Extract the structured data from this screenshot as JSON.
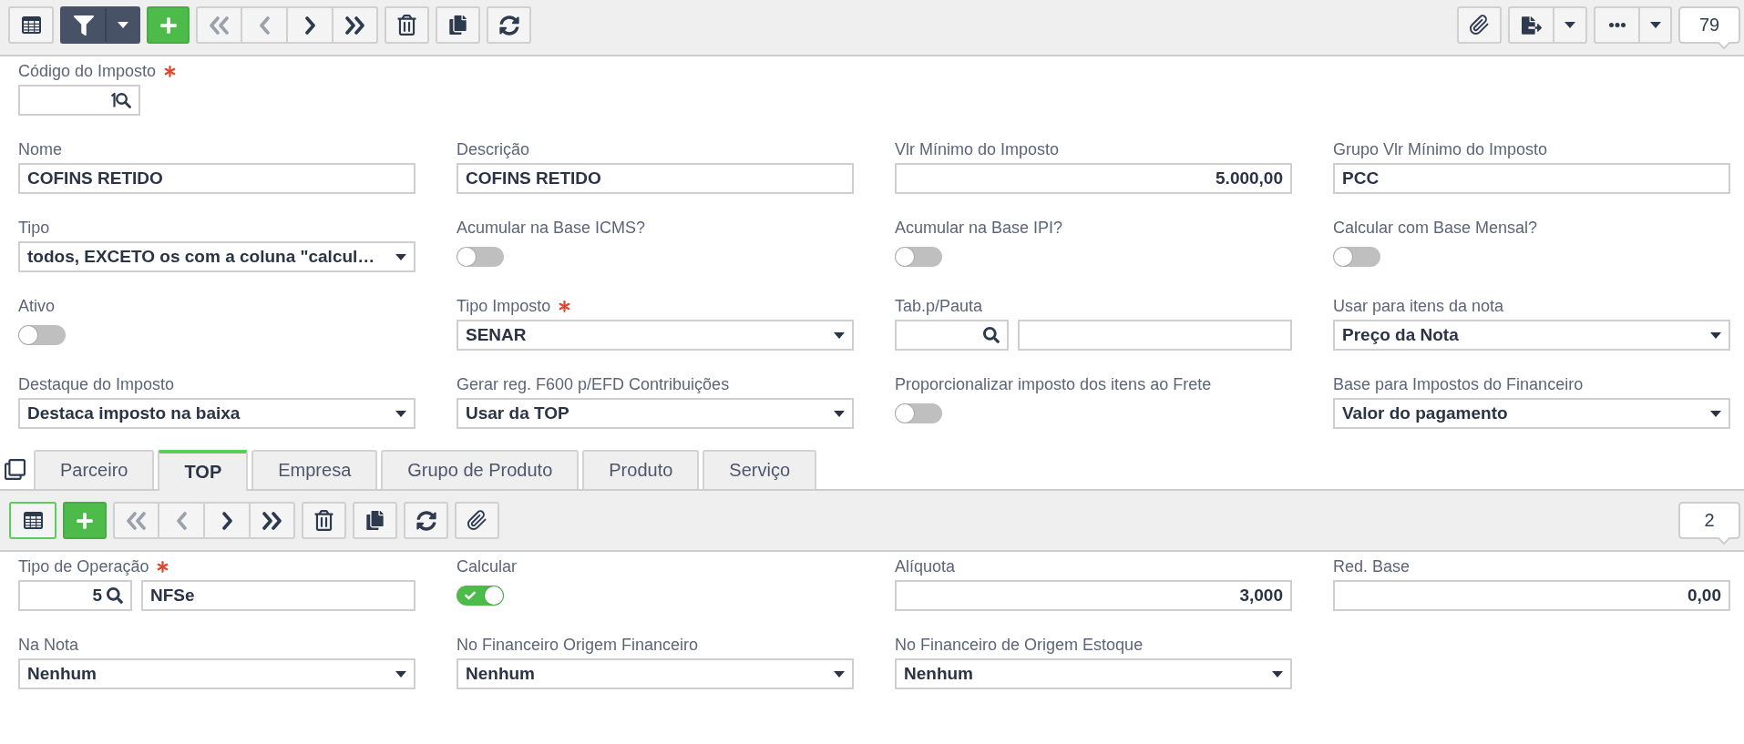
{
  "toolbar": {
    "grid_active": false,
    "navigation": [
      {
        "disabled": true
      },
      {
        "disabled": true
      },
      {
        "disabled": false
      },
      {
        "disabled": false
      }
    ],
    "record_count": "79"
  },
  "main_form": {
    "code_field": {
      "label": "Código do Imposto",
      "required": true
    },
    "fields": [
      {
        "kind": "text",
        "label": "Nome",
        "required": false,
        "value": "COFINS RETIDO"
      },
      {
        "kind": "text",
        "label": "Descrição",
        "required": false,
        "value": "COFINS RETIDO"
      },
      {
        "kind": "number",
        "label": "Vlr Mínimo do Imposto",
        "required": false,
        "value": "5.000,00"
      },
      {
        "kind": "text",
        "label": "Grupo Vlr Mínimo do Imposto",
        "required": false,
        "value": "PCC"
      },
      {
        "kind": "select",
        "label": "Tipo",
        "required": false,
        "value": "todos, EXCETO os com a coluna \"calcul…"
      },
      {
        "kind": "toggle",
        "label": "Acumular na Base ICMS?",
        "required": false,
        "on": false
      },
      {
        "kind": "toggle",
        "label": "Acumular na Base IPI?",
        "required": false,
        "on": false
      },
      {
        "kind": "toggle",
        "label": "Calcular com Base Mensal?",
        "required": false,
        "on": false
      },
      {
        "kind": "toggle",
        "label": "Ativo",
        "required": false,
        "on": false
      },
      {
        "kind": "select",
        "label": "Tipo Imposto",
        "required": true,
        "value": "SENAR"
      },
      {
        "kind": "lookup",
        "label": "Tab.p/Pauta",
        "required": false
      },
      {
        "kind": "select",
        "label": "Usar para itens da nota",
        "required": false,
        "value": "Preço da Nota"
      },
      {
        "kind": "select",
        "label": "Destaque do Imposto",
        "required": false,
        "value": "Destaca imposto na baixa"
      },
      {
        "kind": "select",
        "label": "Gerar reg. F600 p/EFD Contribuições",
        "required": false,
        "value": "Usar da TOP"
      },
      {
        "kind": "toggle",
        "label": "Proporcionalizar imposto dos itens ao Frete",
        "required": false,
        "on": false
      },
      {
        "kind": "select",
        "label": "Base para Impostos do Financeiro",
        "required": false,
        "value": "Valor do pagamento"
      }
    ]
  },
  "tabs": [
    {
      "label": "Parceiro",
      "selected": false
    },
    {
      "label": "TOP",
      "selected": true
    },
    {
      "label": "Empresa",
      "selected": false
    },
    {
      "label": "Grupo de Produto",
      "selected": false
    },
    {
      "label": "Produto",
      "selected": false
    },
    {
      "label": "Serviço",
      "selected": false
    }
  ],
  "detail_toolbar": {
    "grid_active": true,
    "navigation": [
      {
        "disabled": true
      },
      {
        "disabled": true
      },
      {
        "disabled": false
      },
      {
        "disabled": false
      }
    ],
    "record_count": "2"
  },
  "detail_form": {
    "fields": [
      {
        "kind": "lookup",
        "label": "Tipo de Operação",
        "required": true,
        "code": "5",
        "description": "NFSe"
      },
      {
        "kind": "toggle",
        "label": "Calcular",
        "required": false,
        "on": true
      },
      {
        "kind": "number",
        "label": "Alíquota",
        "required": false,
        "value": "3,000"
      },
      {
        "kind": "number",
        "label": "Red. Base",
        "required": false,
        "value": "0,00"
      },
      {
        "kind": "select",
        "label": "Na Nota",
        "required": false,
        "value": "Nenhum"
      },
      {
        "kind": "select",
        "label": "No Financeiro Origem Financeiro",
        "required": false,
        "value": "Nenhum"
      },
      {
        "kind": "select",
        "label": "No Financeiro de Origem Estoque",
        "required": false,
        "value": "Nenhum"
      }
    ]
  }
}
